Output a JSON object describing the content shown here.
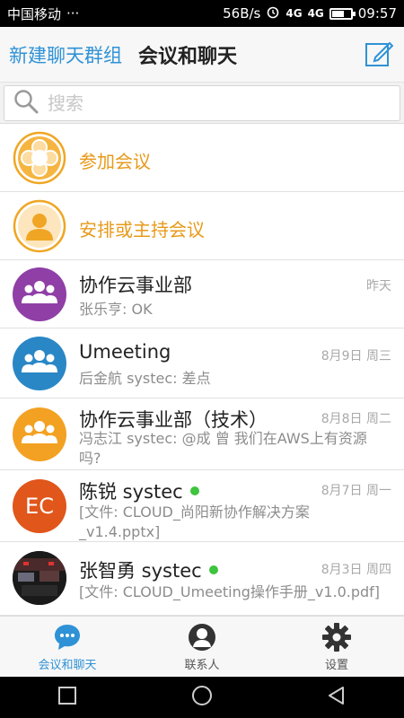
{
  "status_bar": {
    "carrier": "中国移动",
    "dots": "···",
    "speed": "56B/s",
    "net1": "4G",
    "net2": "4G",
    "time": "09:57"
  },
  "header": {
    "new_group": "新建聊天群组",
    "title": "会议和聊天"
  },
  "search": {
    "placeholder": "搜索"
  },
  "meeting_actions": [
    {
      "label": "参加会议",
      "icon": "join-meeting-icon"
    },
    {
      "label": "安排或主持会议",
      "icon": "host-meeting-icon"
    }
  ],
  "chats": [
    {
      "name": "协作云事业部",
      "time": "昨天",
      "message": "张乐亨: OK",
      "avatar_color": "#8f3fa6",
      "online": false
    },
    {
      "name": "Umeeting",
      "time": "8月9日 周三",
      "message": "后金航 systec: 差点",
      "avatar_color": "#2a87c6",
      "online": false
    },
    {
      "name": "协作云事业部（技术）",
      "time": "8月8日 周二",
      "message": "冯志江 systec: @成 曾 我们在AWS上有资源吗?",
      "avatar_color": "#f3a122",
      "online": false
    },
    {
      "name": "陈锐 systec",
      "time": "8月7日 周一",
      "message": "[文件: CLOUD_尚阳新协作解决方案_v1.4.pptx]",
      "avatar_color": "#e0561b",
      "avatar_text": "EC",
      "online": true
    },
    {
      "name": "张智勇 systec",
      "time": "8月3日 周四",
      "message": "[文件: CLOUD_Umeeting操作手册_v1.0.pdf]",
      "avatar_color": "#222222",
      "online": true
    }
  ],
  "bottom_nav": [
    {
      "label": "会议和聊天",
      "icon": "chat-bubble-icon",
      "active": true
    },
    {
      "label": "联系人",
      "icon": "contact-icon",
      "active": false
    },
    {
      "label": "设置",
      "icon": "gear-icon",
      "active": false
    }
  ],
  "colors": {
    "accent_blue": "#2f92d6",
    "meeting_orange": "#e79a1a",
    "online_green": "#3ec43e"
  }
}
